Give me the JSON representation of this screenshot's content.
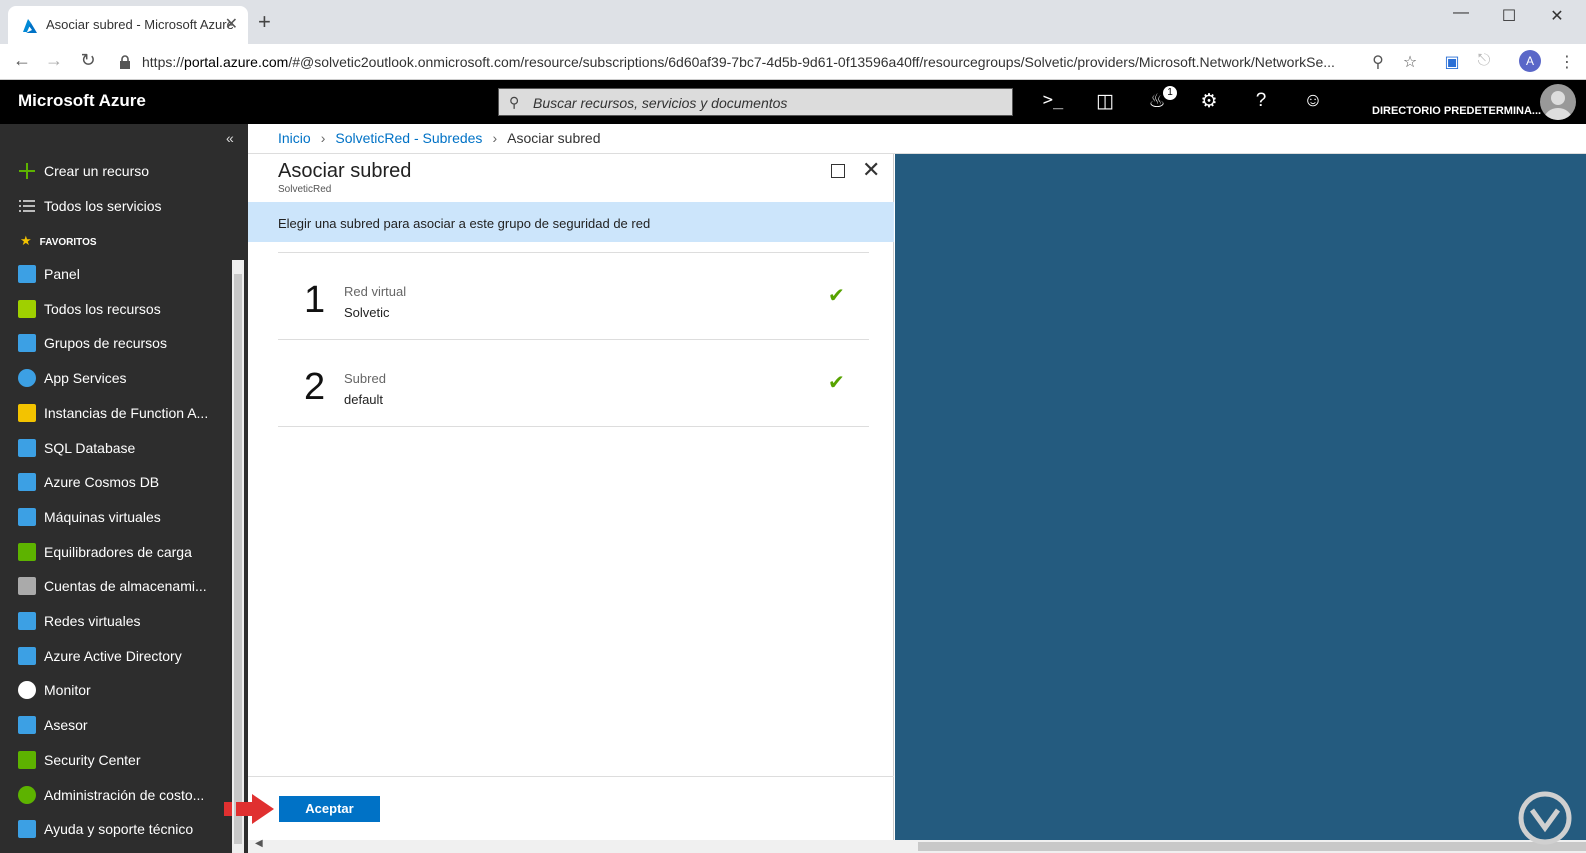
{
  "browser": {
    "tab_title": "Asociar subred - Microsoft Azure",
    "tab_close": "✕",
    "new_tab": "+",
    "url_prefix": "https://",
    "url_host": "portal.azure.com",
    "url_path": "/#@solvetic2outlook.onmicrosoft.com/resource/subscriptions/6d60af39-7bc7-4d5b-9d61-0f13596a40ff/resourcegroups/Solvetic/providers/Microsoft.Network/NetworkSe...",
    "profile_initial": "A"
  },
  "azure_bar": {
    "brand": "Microsoft Azure",
    "search_placeholder": "Buscar recursos, servicios y documentos",
    "notification_count": "1",
    "directory": "DIRECTORIO PREDETERMINA..."
  },
  "sidebar": {
    "collapse": "«",
    "create": "Crear un recurso",
    "all_services": "Todos los servicios",
    "favorites_header": "FAVORITOS",
    "items": [
      {
        "label": "Panel",
        "icon": "dashboard-icon"
      },
      {
        "label": "Todos los recursos",
        "icon": "all-resources-icon"
      },
      {
        "label": "Grupos de recursos",
        "icon": "resource-groups-icon"
      },
      {
        "label": "App Services",
        "icon": "app-services-icon"
      },
      {
        "label": "Instancias de Function A...",
        "icon": "function-app-icon"
      },
      {
        "label": "SQL Database",
        "icon": "sql-database-icon"
      },
      {
        "label": "Azure Cosmos DB",
        "icon": "cosmos-db-icon"
      },
      {
        "label": "Máquinas virtuales",
        "icon": "virtual-machines-icon"
      },
      {
        "label": "Equilibradores de carga",
        "icon": "load-balancer-icon"
      },
      {
        "label": "Cuentas de almacenami...",
        "icon": "storage-accounts-icon"
      },
      {
        "label": "Redes virtuales",
        "icon": "virtual-networks-icon"
      },
      {
        "label": "Azure Active Directory",
        "icon": "active-directory-icon"
      },
      {
        "label": "Monitor",
        "icon": "monitor-icon"
      },
      {
        "label": "Asesor",
        "icon": "advisor-icon"
      },
      {
        "label": "Security Center",
        "icon": "security-center-icon"
      },
      {
        "label": "Administración de costo...",
        "icon": "cost-management-icon"
      },
      {
        "label": "Ayuda y soporte técnico",
        "icon": "help-support-icon"
      }
    ]
  },
  "breadcrumb": {
    "home": "Inicio",
    "parent": "SolveticRed - Subredes",
    "current": "Asociar subred"
  },
  "blade": {
    "title": "Asociar subred",
    "subtitle": "SolveticRed",
    "info": "Elegir una subred para asociar a este grupo de seguridad de red",
    "steps": [
      {
        "number": "1",
        "label": "Red virtual",
        "value": "Solvetic"
      },
      {
        "number": "2",
        "label": "Subred",
        "value": "default"
      }
    ],
    "accept_label": "Aceptar"
  },
  "colors": {
    "accent": "#0072c6",
    "info_bg": "#cce5fb",
    "check": "#57a300",
    "background_panel": "#245b7f"
  }
}
